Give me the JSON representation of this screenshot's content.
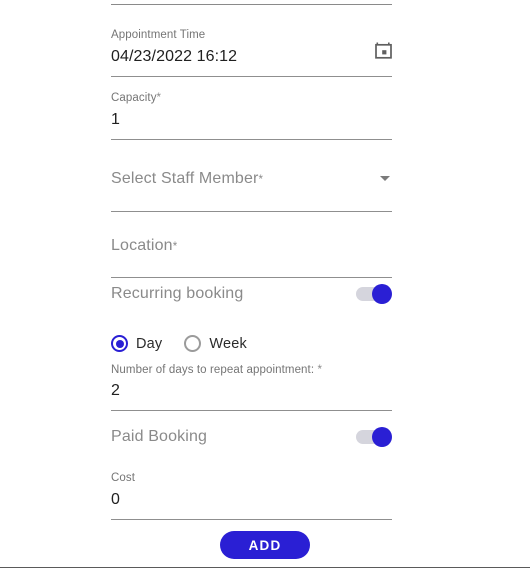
{
  "colors": {
    "accent": "#2a1fd4",
    "label_gray": "#757575",
    "value_dark": "#202020",
    "underline": "#8f8f8f",
    "toggle_track_off": "#d5d5dd"
  },
  "form": {
    "appointment_time": {
      "label": "Appointment Time",
      "value": "04/23/2022 16:12",
      "icon": "calendar-icon"
    },
    "capacity": {
      "label": "Capacity",
      "required_mark": "*",
      "value": "1"
    },
    "staff_member": {
      "placeholder": "Select Staff Member",
      "required_mark": "*",
      "value": "",
      "icon": "chevron-down-icon"
    },
    "location": {
      "placeholder": "Location",
      "required_mark": "*",
      "value": ""
    },
    "recurring_booking": {
      "label": "Recurring booking",
      "state": "on"
    },
    "repeat_frequency": {
      "options": [
        {
          "label": "Day",
          "selected": true
        },
        {
          "label": "Week",
          "selected": false
        }
      ]
    },
    "repeat_count": {
      "label": "Number of days to repeat appointment:",
      "required_mark": "*",
      "value": "2"
    },
    "paid_booking": {
      "label": "Paid Booking",
      "state": "on"
    },
    "cost": {
      "label": "Cost",
      "value": "0"
    },
    "submit": {
      "label": "ADD"
    }
  }
}
